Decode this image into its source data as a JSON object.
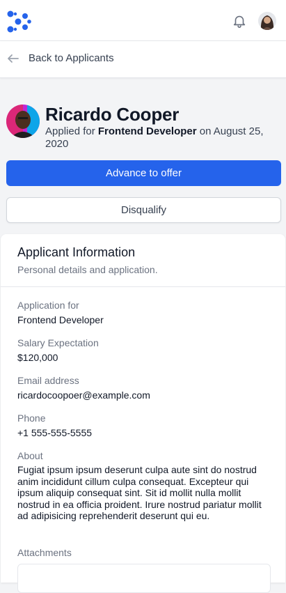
{
  "colors": {
    "brand": "#2563eb",
    "text_primary": "#111827",
    "text_secondary": "#6b7280",
    "background": "#f3f4f6"
  },
  "header": {
    "logo_icon": "brand-logo-icon",
    "notifications_icon": "bell-icon",
    "user_avatar": "user-avatar"
  },
  "back": {
    "label": "Back to Applicants",
    "icon": "arrow-left-icon"
  },
  "applicant": {
    "name": "Ricardo Cooper",
    "applied_prefix": "Applied for",
    "role": "Frontend Developer",
    "applied_suffix": "on August 25, 2020"
  },
  "actions": {
    "advance_label": "Advance to offer",
    "disqualify_label": "Disqualify"
  },
  "info": {
    "title": "Applicant Information",
    "subtitle": "Personal details and application.",
    "fields": [
      {
        "label": "Application for",
        "value": "Frontend Developer"
      },
      {
        "label": "Salary Expectation",
        "value": "$120,000"
      },
      {
        "label": "Email address",
        "value": "ricardocoopoer@example.com"
      },
      {
        "label": "Phone",
        "value": "+1 555-555-5555"
      },
      {
        "label": "About",
        "value": "Fugiat ipsum ipsum deserunt culpa aute sint do nostrud anim incididunt cillum culpa consequat. Excepteur qui ipsum aliquip consequat sint. Sit id mollit nulla mollit nostrud in ea officia proident. Irure nostrud pariatur mollit ad adipisicing reprehenderit deserunt qui eu."
      },
      {
        "label": "Attachments",
        "value": ""
      }
    ]
  }
}
